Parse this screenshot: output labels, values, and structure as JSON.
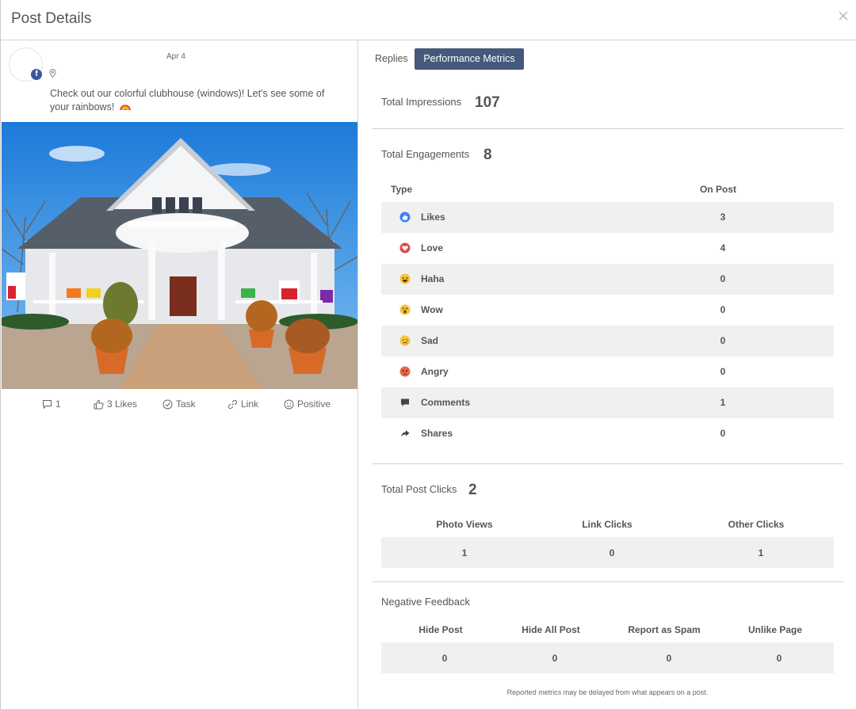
{
  "modal": {
    "title": "Post Details"
  },
  "post": {
    "date": "Apr 4",
    "text": "Check out our colorful clubhouse (windows)! Let's see some of your rainbows!",
    "actions": {
      "comments": "1",
      "likes": "3 Likes",
      "task": "Task",
      "link": "Link",
      "sentiment": "Positive"
    }
  },
  "tabs": {
    "replies": "Replies",
    "performance": "Performance Metrics"
  },
  "impressions": {
    "label": "Total Impressions",
    "value": "107"
  },
  "engagements": {
    "label": "Total Engagements",
    "value": "8",
    "col_type": "Type",
    "col_on_post": "On Post",
    "rows": [
      {
        "icon": "like-icon",
        "label": "Likes",
        "value": "3"
      },
      {
        "icon": "love-icon",
        "label": "Love",
        "value": "4"
      },
      {
        "icon": "haha-icon",
        "label": "Haha",
        "value": "0"
      },
      {
        "icon": "wow-icon",
        "label": "Wow",
        "value": "0"
      },
      {
        "icon": "sad-icon",
        "label": "Sad",
        "value": "0"
      },
      {
        "icon": "angry-icon",
        "label": "Angry",
        "value": "0"
      },
      {
        "icon": "comment-icon",
        "label": "Comments",
        "value": "1"
      },
      {
        "icon": "share-icon",
        "label": "Shares",
        "value": "0"
      }
    ]
  },
  "post_clicks": {
    "label": "Total Post Clicks",
    "value": "2",
    "headers": [
      "Photo Views",
      "Link Clicks",
      "Other Clicks"
    ],
    "values": [
      "1",
      "0",
      "1"
    ]
  },
  "negative_feedback": {
    "label": "Negative Feedback",
    "headers": [
      "Hide Post",
      "Hide All Post",
      "Report as Spam",
      "Unlike Page"
    ],
    "values": [
      "0",
      "0",
      "0",
      "0"
    ]
  },
  "footnote": "Reported metrics may be delayed from what appears on a post.",
  "colors": {
    "tab_active": "#455a7a",
    "facebook": "#3b5998",
    "like_blue": "#3b82f6",
    "love_red": "#e0474c",
    "emoji_yellow": "#f5c33b"
  }
}
